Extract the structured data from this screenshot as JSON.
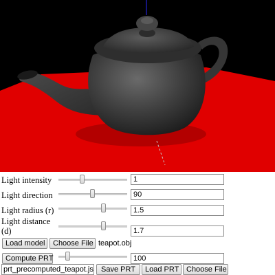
{
  "viewport": {
    "background": "#000000",
    "plane_color": "#e00000",
    "teapot_color": "#3c3c3c"
  },
  "controls": {
    "light_intensity": {
      "label": "Light intensity",
      "value": "1",
      "slider": 0.35
    },
    "light_direction": {
      "label": "Light direction",
      "value": "90",
      "slider": 0.5
    },
    "light_radius": {
      "label": "Light radius (r)",
      "value": "1.5",
      "slider": 0.62
    },
    "light_distance": {
      "label_line1": "Light distance",
      "label_line2": "(d)",
      "value": "1.7",
      "slider": 0.62
    }
  },
  "model": {
    "load_label": "Load model",
    "choose_label": "Choose File",
    "file_name": "teapot.obj"
  },
  "prt": {
    "compute_label": "Compute PRT",
    "samples_value": "100",
    "samples_slider": 0.12,
    "file_name": "prt_precomputed_teapot.json",
    "save_label": "Save PRT",
    "load_label": "Load PRT",
    "choose_label": "Choose File"
  }
}
